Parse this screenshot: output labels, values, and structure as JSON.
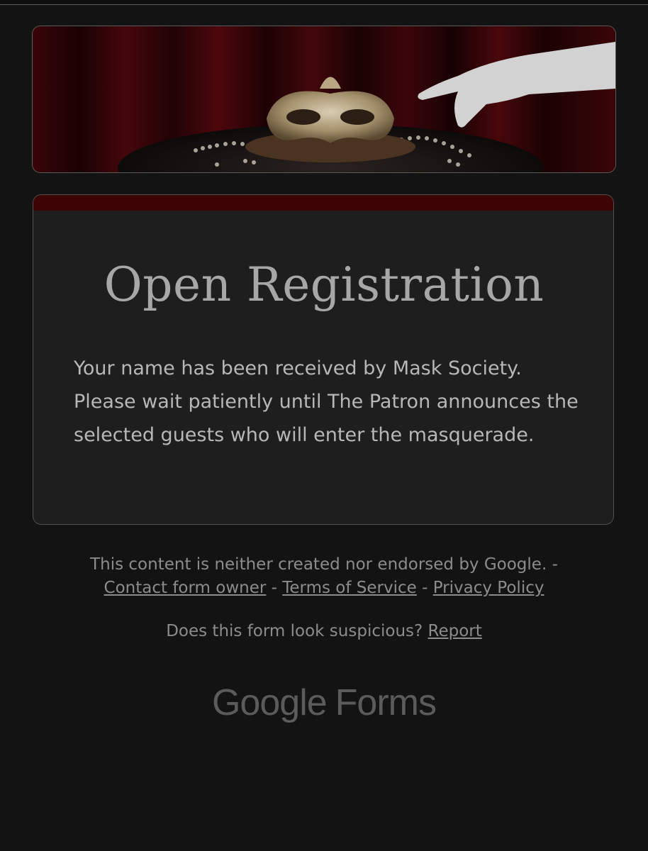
{
  "banner": {
    "alt": "Masquerade mask on pearls with a gloved hand"
  },
  "card": {
    "accent_color": "#3e0304",
    "title": "Open Registration",
    "message": "Your name has been received by Mask Society. Please wait patiently until The Patron announces the selected guests who will enter the masquerade."
  },
  "footer": {
    "disclaimer": "This content is neither created nor endorsed by Google.",
    "separator": " - ",
    "links": {
      "contact": "Contact form owner",
      "terms": "Terms of Service",
      "privacy": "Privacy Policy"
    },
    "suspicious_text": "Does this form look suspicious?",
    "report": "Report"
  },
  "logo": {
    "google": "Google",
    "forms": "Forms"
  }
}
